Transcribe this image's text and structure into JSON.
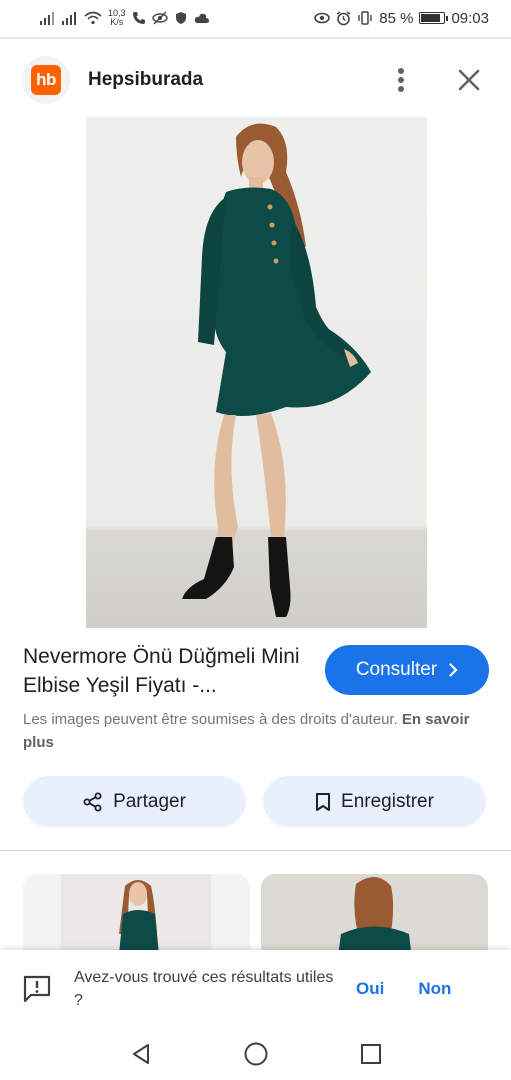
{
  "status_bar": {
    "network_speed_value": "10,3",
    "network_speed_unit": "K/s",
    "battery_percent": "85 %",
    "battery_level": 0.85,
    "time": "09:03"
  },
  "header": {
    "logo_text": "hb",
    "site_name": "Hepsiburada",
    "icons": [
      "more-vert-icon",
      "close-icon"
    ]
  },
  "result": {
    "title": "Nevermore Önü Düğmeli Mini Elbise Yeşil Fiyatı -...",
    "consult_label": "Consulter",
    "copyright_notice": "Les images peuvent être soumises à des droits d'auteur.",
    "learn_more": "En savoir plus"
  },
  "actions": {
    "share_label": "Partager",
    "save_label": "Enregistrer"
  },
  "feedback": {
    "question": "Avez-vous trouvé ces résultats utiles ?",
    "yes_label": "Oui",
    "no_label": "Non"
  },
  "colors": {
    "accent": "#1a73e8",
    "action_bg": "#e8f0fe",
    "brand": "#ff6000",
    "dress": "#0e4a46"
  }
}
